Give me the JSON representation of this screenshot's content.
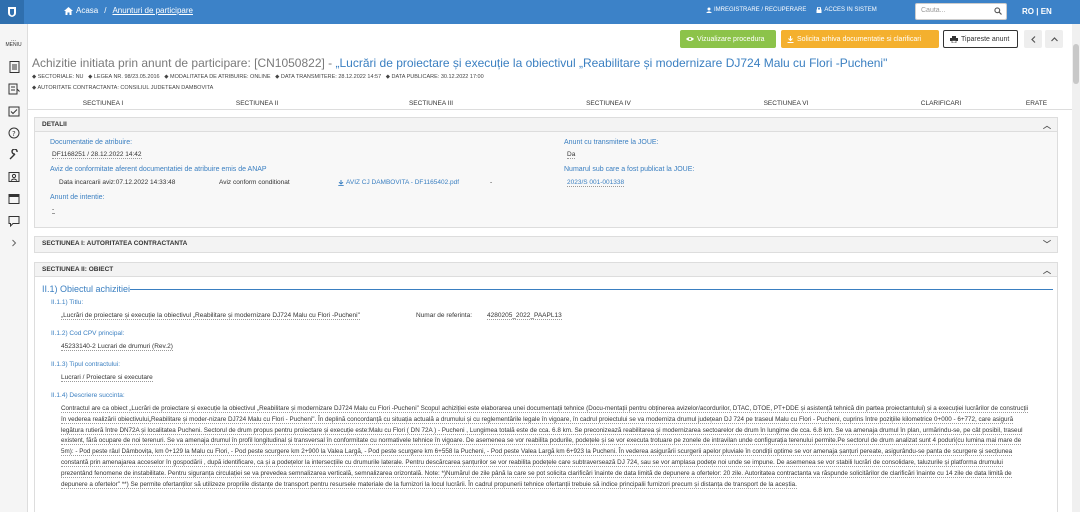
{
  "topbar": {
    "breadcrumb_home": "Acasa",
    "breadcrumb_sep": "/",
    "breadcrumb_current": "Anunturi de participare",
    "register_link": "IMREGISTRARE / RECUPERARE",
    "login_link": "ACCES IN SISTEM",
    "search_placeholder": "Cauta...",
    "lang_ro": "RO",
    "lang_sep": "|",
    "lang_en": "EN"
  },
  "sidebar": {
    "menu_label": "MENIU"
  },
  "actions": {
    "view_procedure": "Vizualizare procedura",
    "request_archive": "Solicita arhiva documentatie si clarificari",
    "print_notice": "Tipareste anunt"
  },
  "notice": {
    "title_prefix": "Achizitie initiata prin anunt de participare: [CN1050822] - ",
    "title_name": "„Lucrări de proiectare și execuție la obiectivul „Reabilitare și modernizare DJ724 Malu cu Flori -Pucheni\"",
    "sectorial": "SECTORIALE: NU",
    "law": "LEGEA NR. 98/23.05.2016",
    "award_mode": "MODALITATEA DE ATRIBUIRE: ONLINE",
    "transmission_date": "DATA TRANSMITERE: 28.12.2022 14:57",
    "publication_date": "DATA PUBLICARE: 30.12.2022 17:00",
    "authority": "AUTORITATE CONTRACTANTA: CONSILIUL JUDETEAN DAMBOVITA"
  },
  "tabs": [
    "SECTIUNEA I",
    "SECTIUNEA II",
    "SECTIUNEA III",
    "SECTIUNEA IV",
    "SECTIUNEA VI",
    "CLARIFICARI",
    "ERATE"
  ],
  "detalii": {
    "header": "DETALII",
    "doc_label": "Documentatie de atribuire:",
    "doc_value": "DF1168251 / 28.12.2022 14:42",
    "anap_label": "Aviz de conformitate aferent documentatiei de atribuire emis de ANAP",
    "anap_date": "Data incarcarii aviz:07.12.2022 14:33:48",
    "anap_status": "Aviz conform conditionat",
    "anap_file": "AVIZ CJ DAMBOVITA - DF1165402.pdf",
    "anap_dash": "-",
    "intent_label": "Anunt de intentie:",
    "intent_value": "-",
    "joue_label": "Anunt cu transmitere la JOUE:",
    "joue_value": "Da",
    "joue_num_label": "Numarul sub care a fost publicat la JOUE:",
    "joue_num_value": "2023/S 001-001338"
  },
  "sectiunea1": {
    "header": "SECTIUNEA I: AUTORITATEA CONTRACTANTA"
  },
  "sectiunea2": {
    "header": "SECTIUNEA II: OBIECT",
    "object_heading": "II.1) Obiectul achizitiei",
    "title_label": "II.1.1) Titlu:",
    "title_value": "„Lucrări de proiectare și execuție la obiectivul „Reabilitare și modernizare DJ724 Malu cu Flori -Pucheni\"",
    "ref_label": "Numar de referinta:",
    "ref_value": "4280205_2022_PAAPL13",
    "cpv_label": "II.1.2) Cod CPV principal:",
    "cpv_value": "45233140-2 Lucrari de drumuri (Rev.2)",
    "type_label": "II.1.3) Tipul contractului:",
    "type_value": "Lucrari / Proiectare si executare",
    "desc_label": "II.1.4) Descriere succinta:",
    "desc_value": "Contractul are ca obiect „Lucrări de proiectare și execuție la obiectivul „Reabilitare și modernizare DJ724 Malu cu Flori -Pucheni\" Scopul achiziției este elaborarea unei documentații tehnice (Docu-mentații pentru obținerea avizelor/acordurilor, DTAC, DTOE, PT+DDE și asistență tehnică din partea proiectantului) și a execuției lucrărilor de construcții în vederea realizării obiectivului„Reabilitare și moder-nizare DJ724 Malu cu Flori - Pucheni\". În deplină concordanță cu situația actuală a drumului și cu reglementările legale în vigoare, în cadrul proiectului se va moderniza drumul județean DJ 724 pe traseul Malu cu Flori - Pucheni, cuprins între pozițiile kilometrice 0+000 - 6+772, care asigură legătura rutieră între DN72A și localitatea Pucheni. Sectorul de drum propus pentru proiectare și execuție este:Malu cu Flori ( DN 72A ) - Pucheni , Lungimea totală este de cca. 6.8 km. Se preconizează reabilitarea și modernizarea sectoarelor de drum în lungime de cca. 6.8 km. Se va amenaja drumul în plan, urmărindu-se, pe cât posibil, traseul existent, fără ocupare de noi terenuri. Se va amenaja drumul în profil longitudinal și transversal în conformitate cu normativele tehnice în vigoare. De asemenea se vor reabilita podurile, podețele și se vor executa trotuare pe zonele de intravilan unde configurația terenului permite.Pe sectorul de drum analizat sunt 4 poduri(cu lumina mai mare de 5m): - Pod peste râul Dâmbovița, km 0+129 la Malu cu Flori, - Pod peste scurgere km 2+900 la Valea Largă, - Pod peste scurgere km 6+558 la Pucheni, - Pod peste Valea Largă km 6+923 la Pucheni. În vederea asigurării scurgerii apelor pluviale în condiții optime se vor amenaja șanțuri pereate, asigurându-se panta de scurgere și secțiunea constantă prin amenajarea acceselor în gospodării , după identificare, ca și a podețelor la intersecțiile cu drumurile laterale. Pentru descărcarea șanțurilor se vor reabilita podețele care subtraversează DJ 724, sau se vor amplasa podețe noi unde se impune. De asemenea se vor stabili lucrări de consolidare, taluzurile și platforma drumului prezentând fenomene de instabilitate. Pentru siguranța circulației se va prevedea semnalizarea verticală, semnalizarea orizontală. Note: *)Numărul de zile până la care se pot solicita clarificări înainte de data limită de depunere a ofertelor: 20 zile. Autoritatea contractanta va răspunde solicitărilor de clarificări înainte cu 14 zile de data limită de depunere a ofertelor\" **) Se permite ofertanților să utilizeze propriile distanțe de transport pentru resursele materiale de la furnizori la locul lucrării. În cadrul propunerii tehnice ofertanții trebuie să indice principalii furnizori precum și distanța de transport de la aceștia."
  }
}
